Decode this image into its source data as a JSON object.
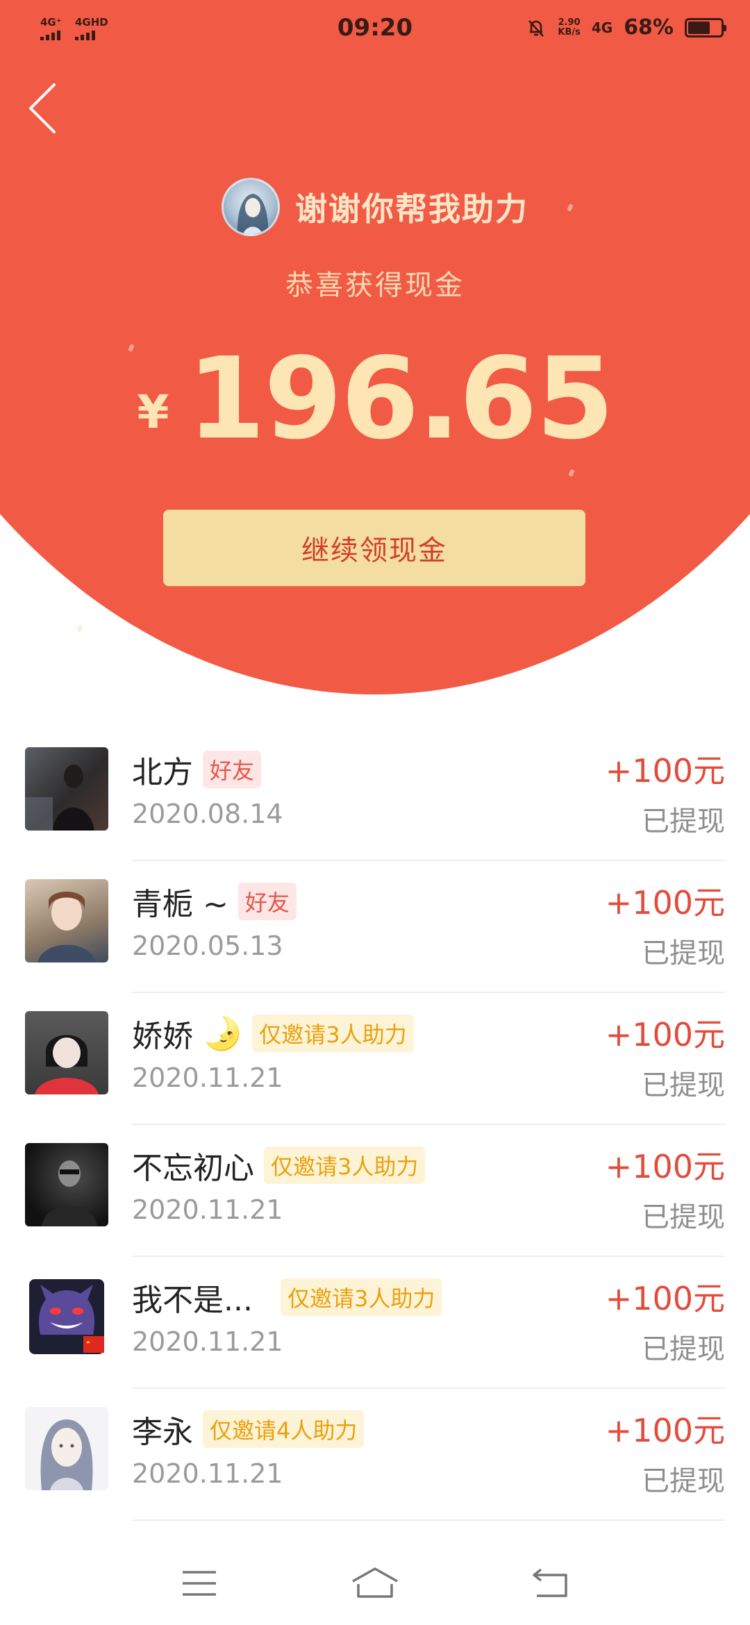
{
  "status_bar": {
    "sim1": "4G⁺",
    "sim2": "4GHD",
    "time": "09:20",
    "speed_value": "2.90",
    "speed_unit": "KB/s",
    "network": "4G",
    "battery_percent": "68%",
    "battery_level": 0.68
  },
  "header": {
    "title": "谢谢你帮我助力",
    "subtitle": "恭喜获得现金",
    "currency": "¥",
    "amount": "196.65",
    "cta_label": "继续领现金"
  },
  "colors": {
    "hero_red": "#f15b45",
    "cta_bg": "#f4dda0",
    "reward_red": "#e34b3b",
    "invite_tag": "#e9a10e"
  },
  "list": [
    {
      "name": "北方",
      "tag": "好友",
      "tag_type": "friend",
      "date": "2020.08.14",
      "reward": "+100元",
      "status": "已提现"
    },
    {
      "name": "青栀 ~",
      "tag": "好友",
      "tag_type": "friend",
      "date": "2020.05.13",
      "reward": "+100元",
      "status": "已提现"
    },
    {
      "name": "娇娇",
      "emoji": "🌛",
      "tag": "仅邀请3人助力",
      "tag_type": "invite",
      "date": "2020.11.21",
      "reward": "+100元",
      "status": "已提现"
    },
    {
      "name": "不忘初心",
      "tag": "仅邀请3人助力",
      "tag_type": "invite",
      "date": "2020.11.21",
      "reward": "+100元",
      "status": "已提现"
    },
    {
      "name": "我不是...",
      "tag": "仅邀请3人助力",
      "tag_type": "invite",
      "date": "2020.11.21",
      "reward": "+100元",
      "status": "已提现"
    },
    {
      "name": "李永",
      "tag": "仅邀请4人助力",
      "tag_type": "invite",
      "date": "2020.11.21",
      "reward": "+100元",
      "status": "已提现"
    }
  ],
  "nav": {
    "menu_icon": "menu-icon",
    "home_icon": "home-icon",
    "back_icon": "return-icon"
  }
}
